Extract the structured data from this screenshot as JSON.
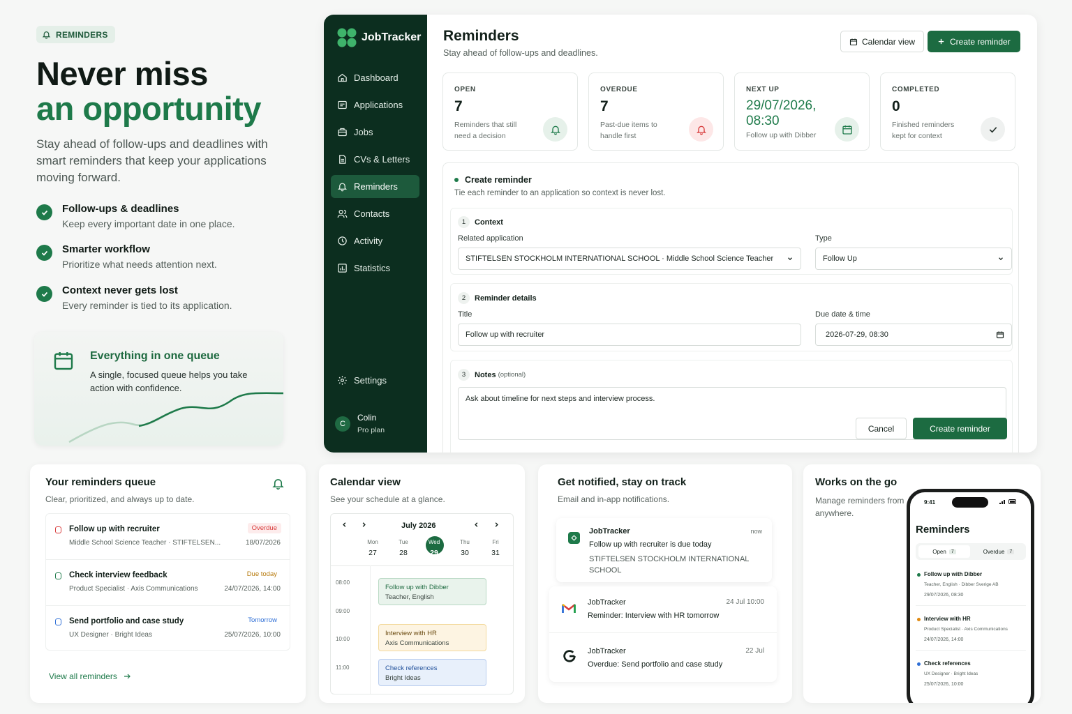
{
  "hero": {
    "badge": "REMINDERS",
    "title_line1": "Never miss",
    "title_line2": "an opportunity",
    "lead": "Stay ahead of follow-ups and deadlines with smart reminders that keep your applications moving forward.",
    "features": [
      {
        "title": "Follow-ups & deadlines",
        "desc": "Keep every important date in one place."
      },
      {
        "title": "Smarter workflow",
        "desc": "Prioritize what needs attention next."
      },
      {
        "title": "Context never gets lost",
        "desc": "Every reminder is tied to its application."
      }
    ],
    "queue_card": {
      "title": "Everything in one queue",
      "desc": "A single, focused queue helps you take action with confidence."
    }
  },
  "app": {
    "brand": "JobTracker",
    "nav": [
      {
        "label": "Dashboard",
        "icon": "home-icon"
      },
      {
        "label": "Applications",
        "icon": "briefcase-icon"
      },
      {
        "label": "Jobs",
        "icon": "jobs-icon"
      },
      {
        "label": "CVs & Letters",
        "icon": "document-icon"
      },
      {
        "label": "Reminders",
        "icon": "bell-icon",
        "active": true
      },
      {
        "label": "Contacts",
        "icon": "contacts-icon"
      },
      {
        "label": "Activity",
        "icon": "activity-icon"
      },
      {
        "label": "Statistics",
        "icon": "chart-icon"
      }
    ],
    "settings": "Settings",
    "user": {
      "initial": "C",
      "name": "Colin",
      "plan": "Pro plan"
    },
    "page_title": "Reminders",
    "page_subtitle": "Stay ahead of follow-ups and deadlines.",
    "calendar_btn": "Calendar view",
    "create_btn": "Create reminder",
    "stats": [
      {
        "label": "OPEN",
        "value": "7",
        "desc": "Reminders that still need a decision",
        "icon": "bell-icon",
        "bg": "#e6f1ea",
        "color": "#1e7a4a"
      },
      {
        "label": "OVERDUE",
        "value": "7",
        "desc": "Past-due items to handle first",
        "icon": "alert-bell-icon",
        "bg": "#fde7e7",
        "color": "#d83b3b"
      },
      {
        "label": "NEXT UP",
        "value": "29/07/2026, 08:30",
        "desc": "Follow up with Dibber",
        "icon": "calendar-icon",
        "bg": "#e6f1ea",
        "color": "#1e7a4a"
      },
      {
        "label": "COMPLETED",
        "value": "0",
        "desc": "Finished reminders kept for context",
        "icon": "check-icon",
        "bg": "#eff1f0",
        "color": "#23302a"
      }
    ],
    "form": {
      "title": "Create reminder",
      "subtitle": "Tie each reminder to an application so context is never lost.",
      "s1": {
        "num": "1",
        "title": "Context",
        "app_label": "Related application",
        "app_value": "STIFTELSEN STOCKHOLM INTERNATIONAL SCHOOL · Middle School Science Teacher",
        "type_label": "Type",
        "type_value": "Follow Up"
      },
      "s2": {
        "num": "2",
        "title": "Reminder details",
        "title_label": "Title",
        "title_value": "Follow up with recruiter",
        "due_label": "Due date & time",
        "due_value": "2026-07-29, 08:30"
      },
      "s3": {
        "num": "3",
        "title": "Notes",
        "optional": "(optional)",
        "notes": "Ask about timeline for next steps and interview process."
      },
      "cancel": "Cancel",
      "submit": "Create reminder"
    }
  },
  "queue": {
    "title": "Your reminders queue",
    "subtitle": "Clear, prioritized, and always up to date.",
    "items": [
      {
        "title": "Follow up with recruiter",
        "sub": "Middle School Science Teacher · STIFTELSEN...",
        "badge": "Overdue",
        "date": "18/07/2026",
        "color": "#d83b3b"
      },
      {
        "title": "Check interview feedback",
        "sub": "Product Specialist · Axis Communications",
        "badge": "Due today",
        "date": "24/07/2026, 14:00",
        "color": "#1e7a4a"
      },
      {
        "title": "Send portfolio and case study",
        "sub": "UX Designer · Bright Ideas",
        "badge": "Tomorrow",
        "date": "25/07/2026, 10:00",
        "color": "#2f6fd6"
      }
    ],
    "link": "View all reminders"
  },
  "calendar": {
    "title": "Calendar view",
    "subtitle": "See your schedule at a glance.",
    "month": "July 2026",
    "days": [
      {
        "dow": "Mon",
        "num": "27"
      },
      {
        "dow": "Tue",
        "num": "28"
      },
      {
        "dow": "Wed",
        "num": "29",
        "today": true
      },
      {
        "dow": "Thu",
        "num": "30"
      },
      {
        "dow": "Fri",
        "num": "31"
      }
    ],
    "times": [
      "08:00",
      "09:00",
      "10:00",
      "11:00"
    ],
    "events": [
      {
        "title": "Follow up with Dibber",
        "sub": "Teacher, English",
        "bg": "#e9f3ec",
        "border": "#b9d9c4",
        "color": "#1e6a40"
      },
      {
        "title": "Interview with HR",
        "sub": "Axis Communications",
        "bg": "#fdf4e2",
        "border": "#f3d99c",
        "color": "#6a4a10"
      },
      {
        "title": "Check references",
        "sub": "Bright Ideas",
        "bg": "#e8f0fb",
        "border": "#b9cdef",
        "color": "#1f4f9a"
      }
    ]
  },
  "notifications": {
    "title": "Get notified, stay on track",
    "subtitle": "Email and in-app notifications.",
    "main": {
      "app": "JobTracker",
      "time": "now",
      "title": "Follow up with recruiter is due today",
      "body": "STIFTELSEN STOCKHOLM INTERNATIONAL SCHOOL"
    },
    "items": [
      {
        "app": "JobTracker",
        "time": "24 Jul 10:00",
        "body": "Reminder: Interview with HR tomorrow",
        "icon": "gmail-icon"
      },
      {
        "app": "JobTracker",
        "time": "22 Jul",
        "body": "Overdue: Send portfolio and case study",
        "icon": "google-icon"
      }
    ]
  },
  "mobile": {
    "title": "Works on the go",
    "subtitle": "Manage reminders from anywhere.",
    "time": "9:41",
    "screen_title": "Reminders",
    "tabs": [
      {
        "label": "Open",
        "count": "7"
      },
      {
        "label": "Overdue",
        "count": "7"
      }
    ],
    "items": [
      {
        "title": "Follow up with Dibber",
        "sub": "Teacher, English · Dibber Sverige AB",
        "date": "29/07/2026, 08:30",
        "color": "#1e7a4a"
      },
      {
        "title": "Interview with HR",
        "sub": "Product Specialist · Axis Communications",
        "date": "24/07/2026, 14:00",
        "color": "#e08a12"
      },
      {
        "title": "Check references",
        "sub": "UX Designer · Bright Ideas",
        "date": "25/07/2026, 10:00",
        "color": "#2f6fd6"
      }
    ]
  },
  "colors": {
    "brand": "#1e7a4a",
    "sidebar": "#0c2e1f",
    "danger": "#d83b3b",
    "info": "#2f6fd6"
  }
}
